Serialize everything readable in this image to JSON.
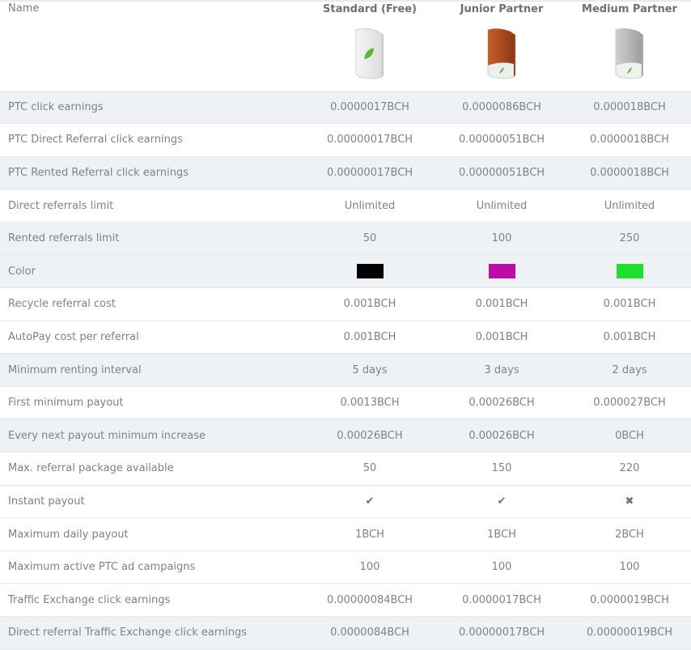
{
  "header": {
    "name_label": "Name",
    "plans": [
      {
        "name": "Standard (Free)",
        "icon": "software-box-white-icon"
      },
      {
        "name": "Junior Partner",
        "icon": "software-box-orange-icon"
      },
      {
        "name": "Medium Partner",
        "icon": "software-box-gray-icon"
      }
    ]
  },
  "rows": [
    {
      "label": "PTC click earnings",
      "values": [
        "0.0000017BCH",
        "0.0000086BCH",
        "0.000018BCH"
      ],
      "shade": "gray"
    },
    {
      "label": "PTC Direct Referral click earnings",
      "values": [
        "0.00000017BCH",
        "0.00000051BCH",
        "0.0000018BCH"
      ],
      "shade": "white"
    },
    {
      "label": "PTC Rented Referral click earnings",
      "values": [
        "0.00000017BCH",
        "0.00000051BCH",
        "0.0000018BCH"
      ],
      "shade": "gray"
    },
    {
      "label": "Direct referrals limit",
      "values": [
        "Unlimited",
        "Unlimited",
        "Unlimited"
      ],
      "shade": "white"
    },
    {
      "label": "Rented referrals limit",
      "values": [
        "50",
        "100",
        "250"
      ],
      "shade": "gray"
    },
    {
      "label": "Color",
      "colors": [
        "#000000",
        "#bb0ca8",
        "#1fe02f"
      ],
      "shade": "gray"
    },
    {
      "label": "Recycle referral cost",
      "values": [
        "0.001BCH",
        "0.001BCH",
        "0.001BCH"
      ],
      "shade": "white"
    },
    {
      "label": "AutoPay cost per referral",
      "values": [
        "0.001BCH",
        "0.001BCH",
        "0.001BCH"
      ],
      "shade": "white"
    },
    {
      "label": "Minimum renting interval",
      "values": [
        "5 days",
        "3 days",
        "2 days"
      ],
      "shade": "gray"
    },
    {
      "label": "First minimum payout",
      "values": [
        "0.0013BCH",
        "0.00026BCH",
        "0.000027BCH"
      ],
      "shade": "white"
    },
    {
      "label": "Every next payout minimum increase",
      "values": [
        "0.00026BCH",
        "0.00026BCH",
        "0BCH"
      ],
      "shade": "gray"
    },
    {
      "label": "Max. referral package available",
      "values": [
        "50",
        "150",
        "220"
      ],
      "shade": "white"
    },
    {
      "label": "Instant payout",
      "marks": [
        "check",
        "check",
        "cross"
      ],
      "mark_glyphs": {
        "check": "✔",
        "cross": "✖"
      },
      "shade": "white"
    },
    {
      "label": "Maximum daily payout",
      "values": [
        "1BCH",
        "1BCH",
        "2BCH"
      ],
      "shade": "white"
    },
    {
      "label": "Maximum active PTC ad campaigns",
      "values": [
        "100",
        "100",
        "100"
      ],
      "shade": "white"
    },
    {
      "label": "Traffic Exchange click earnings",
      "values": [
        "0.00000084BCH",
        "0.0000017BCH",
        "0.0000019BCH"
      ],
      "shade": "white"
    },
    {
      "label": "Direct referral Traffic Exchange click earnings",
      "values": [
        "0.0000084BCH",
        "0.00000017BCH",
        "0.00000019BCH"
      ],
      "shade": "gray"
    }
  ]
}
